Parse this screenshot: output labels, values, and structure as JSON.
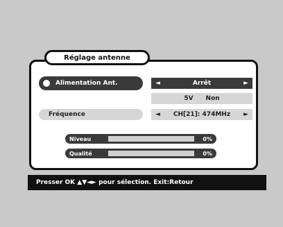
{
  "title": "Réglage antenne",
  "antenna_power": {
    "label": "Alimentation Ant.",
    "value": "Arrêt",
    "sub_values": [
      "5V",
      "Non"
    ]
  },
  "frequency": {
    "label": "Fréquence",
    "value": "CH[21]: 474MHz"
  },
  "signal": {
    "level_label": "Niveau",
    "level_value": "0%",
    "level_fraction": 0,
    "quality_label": "Qualité",
    "quality_value": "0%",
    "quality_fraction": 0
  },
  "help_text": "Presser OK ▲▼◄► pour sélection. Exit:Retour",
  "colors": {
    "panel_dark": "#3a3a3a",
    "panel_light": "#d6d6d6",
    "background": "#c9c9c9"
  },
  "icons": [
    "left-arrow-icon",
    "right-arrow-icon",
    "radio-dot-icon"
  ]
}
